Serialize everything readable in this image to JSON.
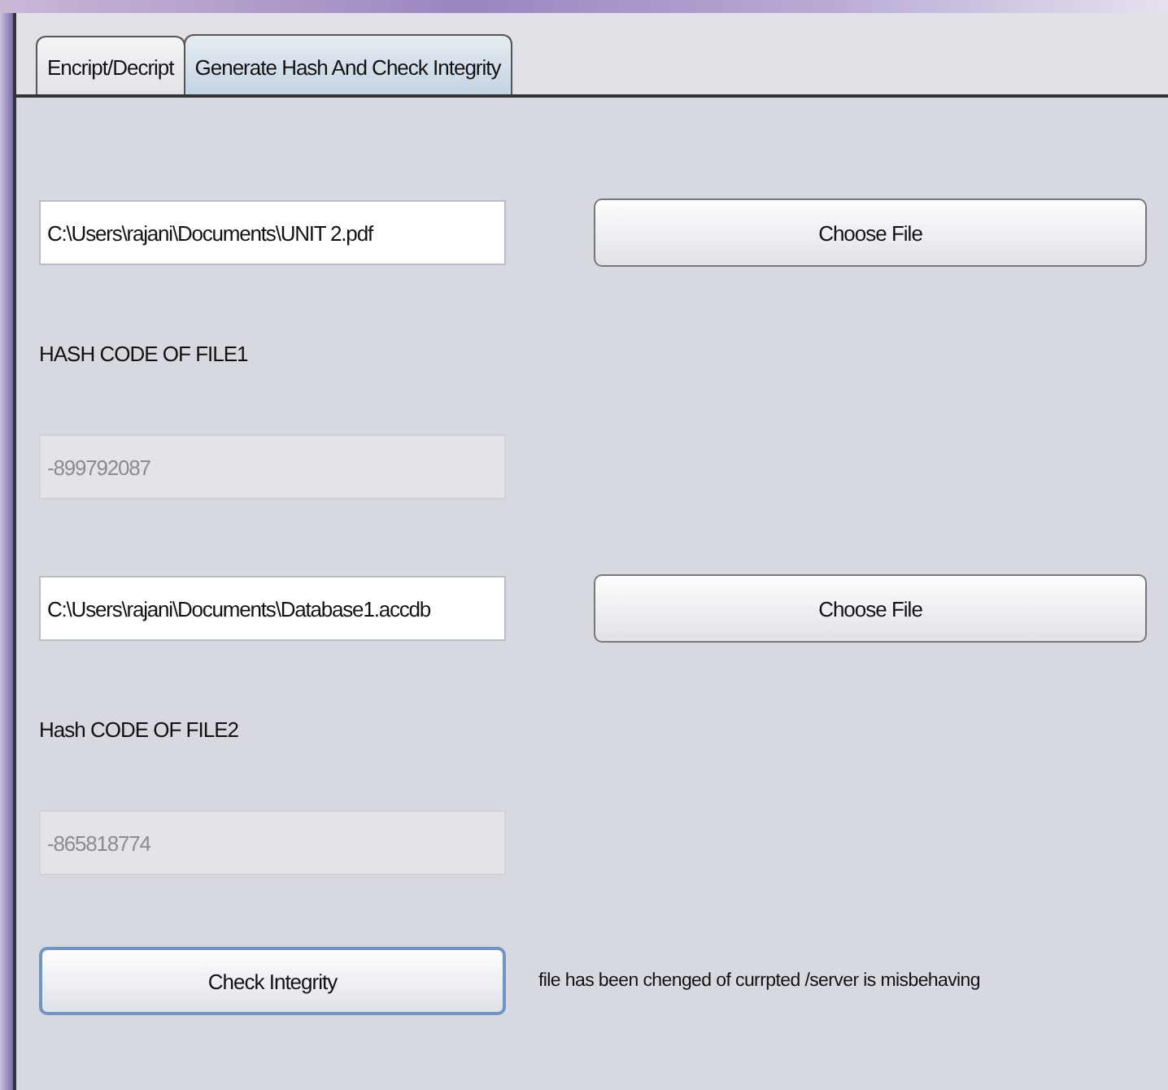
{
  "tabs": [
    {
      "label": "Encript/Decript",
      "selected": false
    },
    {
      "label": "Generate Hash And Check Integrity",
      "selected": true
    }
  ],
  "file1": {
    "path": {
      "value": "C:\\Users\\rajani\\Documents\\UNIT 2.pdf",
      "disabled": false
    },
    "button": {
      "label": "Choose File",
      "focused": false
    }
  },
  "hash1": {
    "label": "HASH CODE OF FILE1",
    "field": {
      "value": "-899792087",
      "disabled": true
    }
  },
  "file2": {
    "path": {
      "value": "C:\\Users\\rajani\\Documents\\Database1.accdb",
      "disabled": false
    },
    "button": {
      "label": "Choose File",
      "focused": false
    }
  },
  "hash2": {
    "label": "Hash CODE OF FILE2",
    "field": {
      "value": "-865818774",
      "disabled": true
    }
  },
  "check": {
    "button": {
      "label": "Check Integrity",
      "focused": true
    },
    "message": "file has been chenged of currpted /server is misbehaving"
  }
}
